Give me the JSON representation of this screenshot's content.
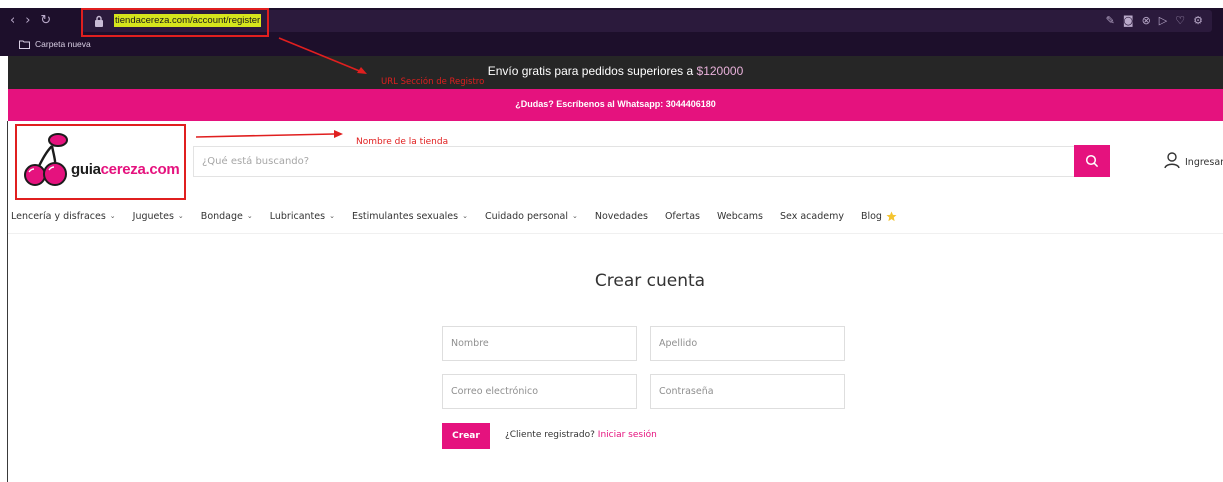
{
  "browser": {
    "nav_icons": [
      "back-icon",
      "forward-icon",
      "reload-icon"
    ],
    "nav_glyphs": [
      "‹",
      "›",
      "↻"
    ],
    "url": "tiendacereza.com/account/register",
    "url_highlight_color": "#d6e51c",
    "address_icons": [
      "edit-icon",
      "screenshot-icon",
      "extension-icon",
      "send-icon",
      "heart-icon",
      "settings-icon"
    ],
    "address_glyphs": [
      "✎",
      "◙",
      "⊗",
      "▷",
      "♡",
      "⚙"
    ],
    "bookmark_folder": "Carpeta nueva"
  },
  "annotations": {
    "url_label": "URL Sección de Registro",
    "store_label": "Nombre de la tienda",
    "color": "#e01f1f"
  },
  "promo": {
    "text": "Envío gratis para pedidos superiores a",
    "amount": "$120000",
    "whatsapp": "¿Dudas? Escríbenos al Whatsapp: 3044406180"
  },
  "header": {
    "logo_part1": "guia",
    "logo_part2": "cereza.com",
    "search_placeholder": "¿Qué está buscando?",
    "login_label": "Ingresar"
  },
  "nav": {
    "items": [
      {
        "label": "Lencería y disfraces",
        "dropdown": true
      },
      {
        "label": "Juguetes",
        "dropdown": true
      },
      {
        "label": "Bondage",
        "dropdown": true
      },
      {
        "label": "Lubricantes",
        "dropdown": true
      },
      {
        "label": "Estimulantes sexuales",
        "dropdown": true
      },
      {
        "label": "Cuidado personal",
        "dropdown": true
      },
      {
        "label": "Novedades",
        "dropdown": false
      },
      {
        "label": "Ofertas",
        "dropdown": false
      },
      {
        "label": "Webcams",
        "dropdown": false
      },
      {
        "label": "Sex academy",
        "dropdown": false
      },
      {
        "label": "Blog",
        "dropdown": false,
        "icon": "star-icon"
      }
    ]
  },
  "form": {
    "title": "Crear cuenta",
    "first_name_placeholder": "Nombre",
    "last_name_placeholder": "Apellido",
    "email_placeholder": "Correo electrónico",
    "password_placeholder": "Contraseña",
    "submit_label": "Crear",
    "registered_text": "¿Cliente registrado?",
    "login_link": "Iniciar sesión"
  },
  "colors": {
    "brand_pink": "#e5127e",
    "promo_dark": "#262626",
    "browser_chrome": "#1d0f2b"
  }
}
